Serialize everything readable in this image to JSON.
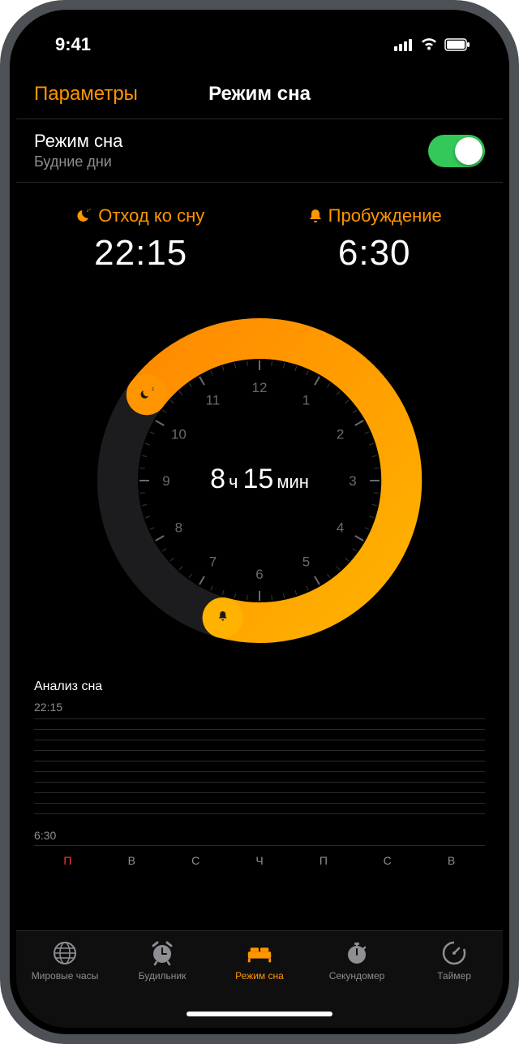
{
  "status": {
    "time": "9:41"
  },
  "nav": {
    "back": "Параметры",
    "title": "Режим сна"
  },
  "toggle": {
    "title": "Режим сна",
    "subtitle": "Будние дни",
    "on": true
  },
  "bedtime": {
    "label": "Отход ко сну",
    "value": "22:15"
  },
  "wake": {
    "label": "Пробуждение",
    "value": "6:30"
  },
  "dial": {
    "duration_hours": "8",
    "hours_unit": "ч",
    "duration_minutes": "15",
    "minutes_unit": "мин",
    "ticks": [
      "12",
      "1",
      "2",
      "3",
      "4",
      "5",
      "6",
      "7",
      "8",
      "9",
      "10",
      "11"
    ]
  },
  "analysis": {
    "title": "Анализ сна",
    "top_time": "22:15",
    "bottom_time": "6:30",
    "days": [
      {
        "label": "П",
        "active": true
      },
      {
        "label": "В",
        "active": false
      },
      {
        "label": "С",
        "active": false
      },
      {
        "label": "Ч",
        "active": false
      },
      {
        "label": "П",
        "active": false
      },
      {
        "label": "С",
        "active": false
      },
      {
        "label": "В",
        "active": false
      }
    ]
  },
  "tabs": [
    {
      "label": "Мировые часы",
      "icon": "world-clock",
      "active": false
    },
    {
      "label": "Будильник",
      "icon": "alarm",
      "active": false
    },
    {
      "label": "Режим сна",
      "icon": "bedtime",
      "active": true
    },
    {
      "label": "Секундомер",
      "icon": "stopwatch",
      "active": false
    },
    {
      "label": "Таймер",
      "icon": "timer",
      "active": false
    }
  ],
  "colors": {
    "accent": "#ff9500",
    "track": "#1c1c1e",
    "grey": "#8e8e93"
  }
}
